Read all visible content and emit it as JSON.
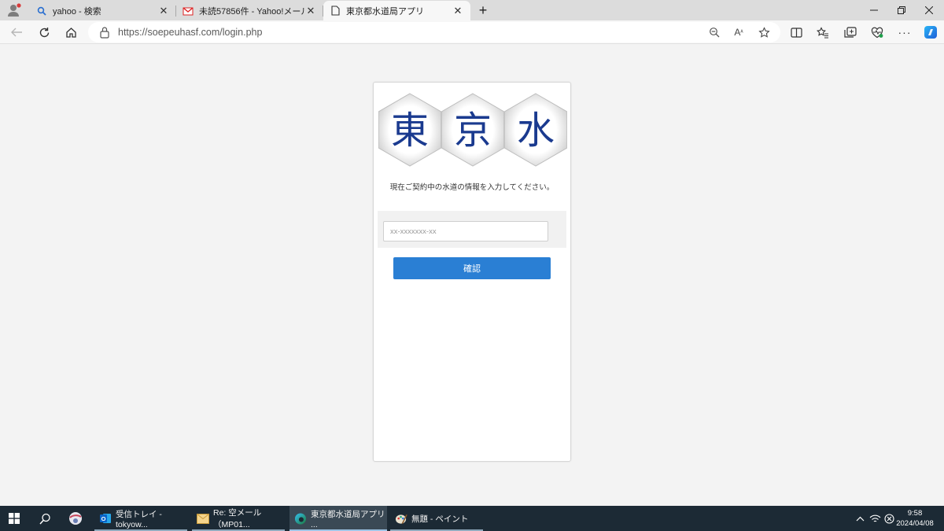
{
  "browser": {
    "tabs": [
      {
        "title": "yahoo - 検索",
        "favicon": "search-icon"
      },
      {
        "title": "未読57856件 - Yahoo!メール",
        "favicon": "yahoo-mail-icon"
      },
      {
        "title": "東京都水道局アプリ",
        "favicon": "page-icon"
      }
    ],
    "address": {
      "url": "https://soepeuhasf.com/login.php"
    }
  },
  "page": {
    "logo_characters": [
      "東",
      "京",
      "水"
    ],
    "logo_color": "#1a3a8f",
    "instruction": "現在ご契約中の水道の情報を入力してください。",
    "customer_number": {
      "value": "",
      "placeholder": "xx-xxxxxxx-xx"
    },
    "confirm_label": "確認",
    "accent_color": "#2a7fd4"
  },
  "taskbar": {
    "apps": [
      {
        "label": "受信トレイ - tokyow...",
        "icon": "outlook-icon"
      },
      {
        "label": "Re: 空メール（MP01...",
        "icon": "mail-icon"
      },
      {
        "label": "東京都水道局アプリ ...",
        "icon": "edge-icon"
      },
      {
        "label": "無題 - ペイント",
        "icon": "paint-icon"
      }
    ],
    "clock": {
      "time": "9:58",
      "date": "2024/04/08"
    }
  }
}
